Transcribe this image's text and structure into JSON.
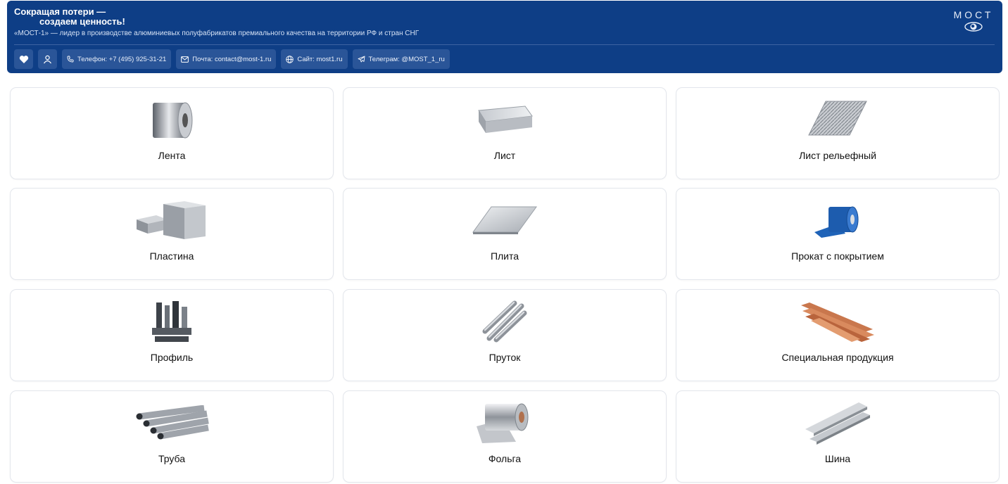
{
  "header": {
    "title_line1": "Сокращая потери —",
    "title_line2": "создаем ценность!",
    "tagline": "«МОСТ-1» — лидер в производстве алюминиевых полуфабрикатов премиального качества на территории РФ и стран СНГ",
    "logo_text": "МОСТ",
    "actions": {
      "favorite_icon": "heart-icon",
      "profile_icon": "user-icon",
      "phone": "Телефон: +7 (495) 925-31-21",
      "email": "Почта: contact@most-1.ru",
      "site": "Сайт: most1.ru",
      "telegram": "Телеграм: @MOST_1_ru"
    }
  },
  "catalog": [
    {
      "label": "Лента",
      "icon": "coil"
    },
    {
      "label": "Лист",
      "icon": "sheet"
    },
    {
      "label": "Лист рельефный",
      "icon": "relief-sheet"
    },
    {
      "label": "Пластина",
      "icon": "plate-blocks"
    },
    {
      "label": "Плита",
      "icon": "slab"
    },
    {
      "label": "Прокат с покрытием",
      "icon": "coated-coil"
    },
    {
      "label": "Профиль",
      "icon": "profiles"
    },
    {
      "label": "Пруток",
      "icon": "rods"
    },
    {
      "label": "Специальная продукция",
      "icon": "copper-strips"
    },
    {
      "label": "Труба",
      "icon": "pipes"
    },
    {
      "label": "Фольга",
      "icon": "foil-roll"
    },
    {
      "label": "Шина",
      "icon": "bus-bars"
    }
  ],
  "colors": {
    "header_bg": "#0e3e86",
    "button_bg": "#2a5598",
    "card_border": "#e3e6ec"
  }
}
